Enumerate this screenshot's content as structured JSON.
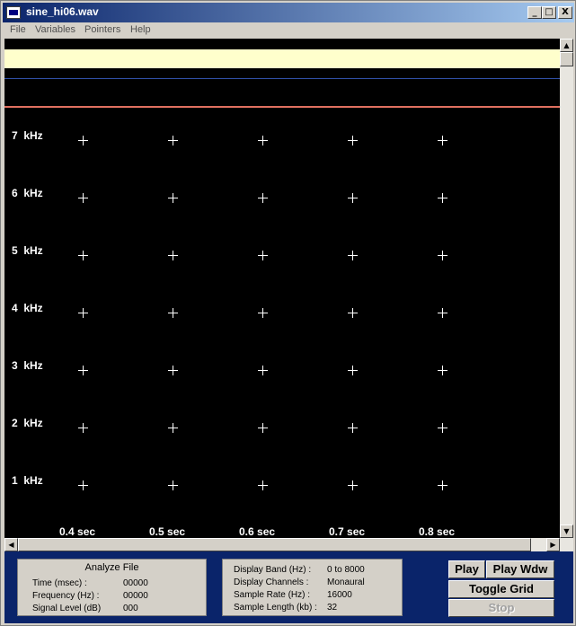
{
  "window": {
    "title": "sine_hi06.wav",
    "controls": {
      "minimize": "_",
      "maximize": "□",
      "close": "X"
    }
  },
  "menu": [
    "File",
    "Variables",
    "Pointers",
    "Help"
  ],
  "spectrogram": {
    "frequency_labels": [
      "7  kHz",
      "6  kHz",
      "5  kHz",
      "4  kHz",
      "3  kHz",
      "2  kHz",
      "1  kHz"
    ],
    "time_labels": [
      "0.4 sec",
      "0.5 sec",
      "0.6 sec",
      "0.7 sec",
      "0.8 sec"
    ],
    "grid_visible": true,
    "colors": {
      "background": "#000000",
      "waveform_band": "#ffffcc",
      "marker_blue": "#3050a8",
      "marker_red": "#e07060"
    }
  },
  "analyze": {
    "heading": "Analyze File",
    "rows": [
      {
        "label": "Time (msec) :",
        "value": "00000"
      },
      {
        "label": "Frequency (Hz) :",
        "value": "00000"
      },
      {
        "label": "Signal Level (dB)",
        "value": "000"
      }
    ]
  },
  "display_info": {
    "rows": [
      {
        "label": "Display Band (Hz) :",
        "value": "0 to 8000"
      },
      {
        "label": "Display Channels :",
        "value": "Monaural"
      },
      {
        "label": "Sample Rate (Hz) :",
        "value": "16000"
      },
      {
        "label": "Sample Length (kb) :",
        "value": "32"
      }
    ]
  },
  "buttons": {
    "play": "Play",
    "play_window": "Play Wdw",
    "toggle_grid": "Toggle Grid",
    "stop": "Stop"
  }
}
